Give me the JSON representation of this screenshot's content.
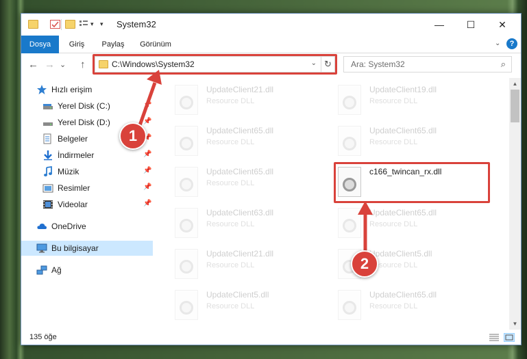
{
  "window": {
    "title": "System32",
    "minimize_glyph": "—",
    "maximize_glyph": "☐",
    "close_glyph": "✕"
  },
  "quick_access_toolbar": {
    "icons": [
      "folder-icon",
      "properties-icon",
      "new-folder-icon",
      "customize-icon"
    ],
    "dropdown_glyph": "▾"
  },
  "ribbon": {
    "tabs": [
      {
        "label": "Dosya",
        "active": true
      },
      {
        "label": "Giriş",
        "active": false
      },
      {
        "label": "Paylaş",
        "active": false
      },
      {
        "label": "Görünüm",
        "active": false
      }
    ],
    "expand_glyph": "⌄",
    "help_glyph": "?"
  },
  "navigation": {
    "back_glyph": "←",
    "forward_glyph": "→",
    "recent_glyph": "⌄",
    "up_glyph": "↑"
  },
  "address_bar": {
    "path": "C:\\Windows\\System32",
    "dropdown_glyph": "⌄",
    "refresh_glyph": "↻"
  },
  "search": {
    "placeholder": "Ara: System32",
    "glyph": "⌕"
  },
  "nav_pane": {
    "quick_access": "Hızlı erişim",
    "items": [
      {
        "label": "Yerel Disk (C:)",
        "icon": "drive-icon",
        "pinned": true
      },
      {
        "label": "Yerel Disk (D:)",
        "icon": "drive-icon",
        "pinned": true
      },
      {
        "label": "Belgeler",
        "icon": "documents-icon",
        "pinned": true
      },
      {
        "label": "İndirmeler",
        "icon": "downloads-icon",
        "pinned": true
      },
      {
        "label": "Müzik",
        "icon": "music-icon",
        "pinned": true
      },
      {
        "label": "Resimler",
        "icon": "pictures-icon",
        "pinned": true
      },
      {
        "label": "Videolar",
        "icon": "videos-icon",
        "pinned": true
      }
    ],
    "onedrive": "OneDrive",
    "this_pc": "Bu bilgisayar",
    "network": "Ağ",
    "pin_glyph": "📌"
  },
  "files": [
    {
      "name": "UpdateClient21.dll",
      "type": "Resource DLL",
      "faded": true
    },
    {
      "name": "UpdateClient19.dll",
      "type": "Resource DLL",
      "faded": true
    },
    {
      "name": "UpdateClient65.dll",
      "type": "Resource DLL",
      "faded": true
    },
    {
      "name": "UpdateClient65.dll",
      "type": "Resource DLL",
      "faded": true
    },
    {
      "name": "UpdateClient65.dll",
      "type": "Resource DLL",
      "faded": true
    },
    {
      "name": "c166_twincan_rx.dll",
      "type": "",
      "faded": false
    },
    {
      "name": "UpdateClient63.dll",
      "type": "Resource DLL",
      "faded": true
    },
    {
      "name": "UpdateClient65.dll",
      "type": "Resource DLL",
      "faded": true
    },
    {
      "name": "UpdateClient21.dll",
      "type": "Resource DLL",
      "faded": true
    },
    {
      "name": "UpdateClient5.dll",
      "type": "Resource DLL",
      "faded": true
    },
    {
      "name": "UpdateClient5.dll",
      "type": "Resource DLL",
      "faded": true
    },
    {
      "name": "UpdateClient65.dll",
      "type": "Resource DLL",
      "faded": true
    }
  ],
  "status_bar": {
    "item_count": "135 öğe"
  },
  "scrollbar": {
    "up_glyph": "▲",
    "down_glyph": "▼"
  },
  "annotations": [
    {
      "number": "1"
    },
    {
      "number": "2"
    }
  ],
  "colors": {
    "accent": "#1979ca",
    "callout": "#d9423b",
    "selection": "#cce8ff"
  }
}
